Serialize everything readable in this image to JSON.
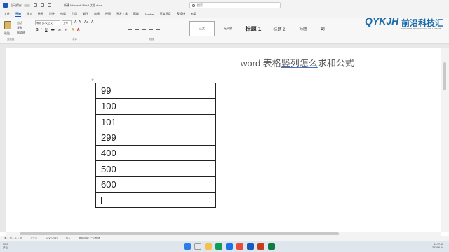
{
  "titlebar": {
    "autosave": "自动保存",
    "toggle_state": "关",
    "doc_title": "新建 Microsoft Word 文档.docx",
    "search_placeholder": "搜索"
  },
  "menu": {
    "items": [
      "文件",
      "开始",
      "插入",
      "绘图",
      "设计",
      "布局",
      "引用",
      "邮件",
      "审阅",
      "视图",
      "开发工具",
      "帮助",
      "Acrobat",
      "百度网盘",
      "表设计",
      "布局"
    ],
    "active_index": 1
  },
  "ribbon": {
    "clipboard": {
      "paste": "粘贴",
      "cut": "剪切",
      "copy": "复制",
      "format_painter": "格式刷",
      "label": "剪贴板"
    },
    "font": {
      "font_name": "等线 (中文正文)",
      "font_size": "五号",
      "label": "字体"
    },
    "paragraph": {
      "label": "段落"
    },
    "styles": [
      "正文",
      "无间隔",
      "标题 1",
      "标题 2",
      "标题",
      "副"
    ]
  },
  "logo": {
    "main": "QYKJH",
    "cn": "前沿科技汇",
    "sub": "FRONTIER TECHNOLOGY COLLECTION"
  },
  "document": {
    "heading": {
      "part1": "word 表格",
      "part2": "竖列",
      "part3": "怎么",
      "part4": "求和公式"
    },
    "table_rows": [
      "99",
      "100",
      "101",
      "299",
      "400",
      "500",
      "600",
      ""
    ]
  },
  "statusbar": {
    "page": "第 1 页，共 1 页",
    "words": "7 个字",
    "lang": "中文(中国)",
    "insert": "插入",
    "accessibility": "辅助功能: 一切就绪"
  },
  "taskbar": {
    "temp": "30°C",
    "weather": "多云",
    "time": "14:37:13",
    "date": "2024-6-14"
  },
  "colors": {
    "word_blue": "#185abd",
    "logo_blue": "#1a6aa8"
  }
}
